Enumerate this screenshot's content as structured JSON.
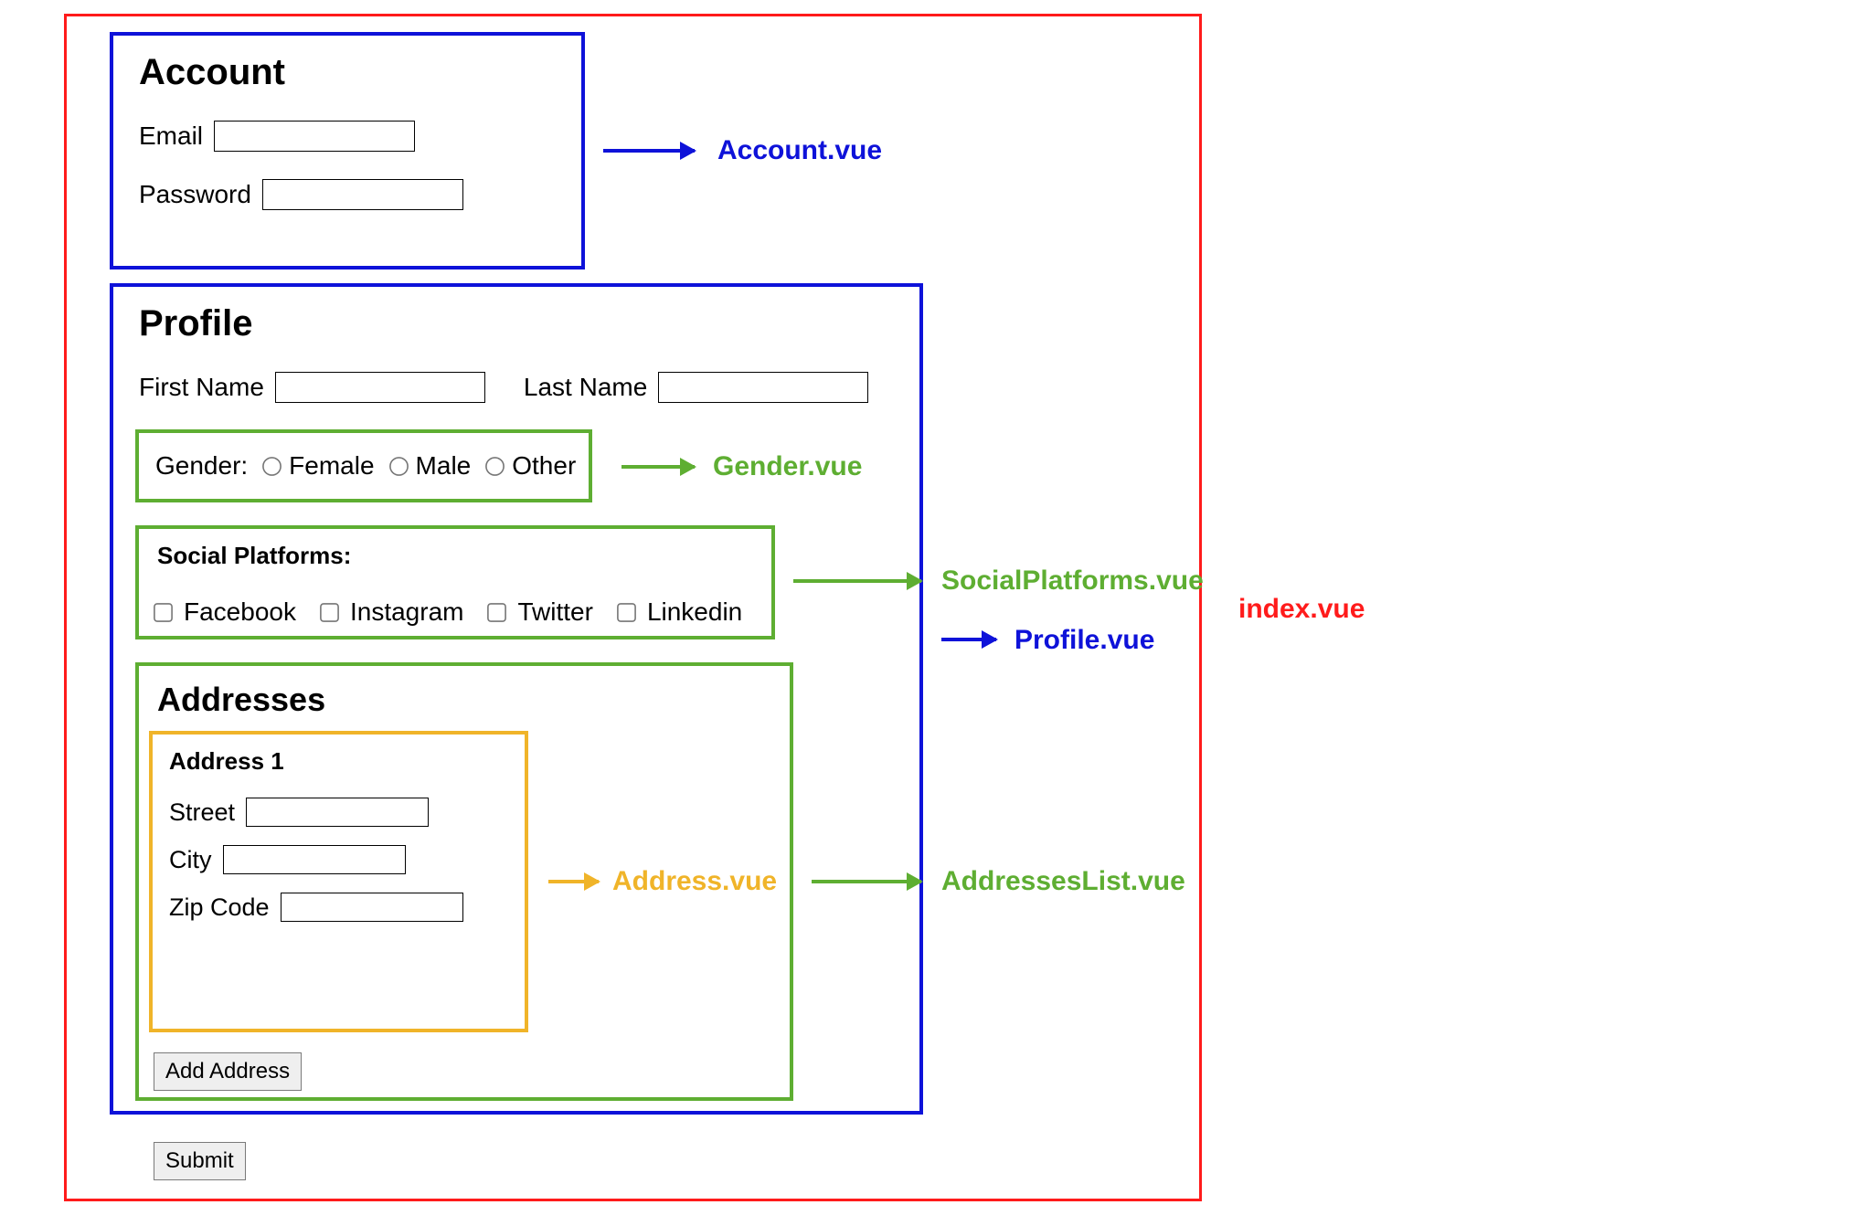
{
  "index_label": "index.vue",
  "account": {
    "title": "Account",
    "email_label": "Email",
    "password_label": "Password",
    "annotation": "Account.vue"
  },
  "profile": {
    "title": "Profile",
    "first_name_label": "First Name",
    "last_name_label": "Last Name",
    "annotation": "Profile.vue",
    "gender": {
      "label": "Gender:",
      "options": {
        "female": "Female",
        "male": "Male",
        "other": "Other"
      },
      "annotation": "Gender.vue"
    },
    "social": {
      "header": "Social Platforms:",
      "options": {
        "facebook": "Facebook",
        "instagram": "Instagram",
        "twitter": "Twitter",
        "linkedin": "Linkedin"
      },
      "annotation": "SocialPlatforms.vue"
    },
    "addresses": {
      "title": "Addresses",
      "annotation": "AddressesList.vue",
      "add_button": "Add Address",
      "item": {
        "header": "Address 1",
        "street_label": "Street",
        "city_label": "City",
        "zip_label": "Zip Code",
        "annotation": "Address.vue"
      }
    }
  },
  "buttons": {
    "submit": "Submit"
  },
  "colors": {
    "red": "#ff1b1b",
    "blue": "#0e12d9",
    "green": "#5eae32",
    "yellow": "#f0b429"
  }
}
